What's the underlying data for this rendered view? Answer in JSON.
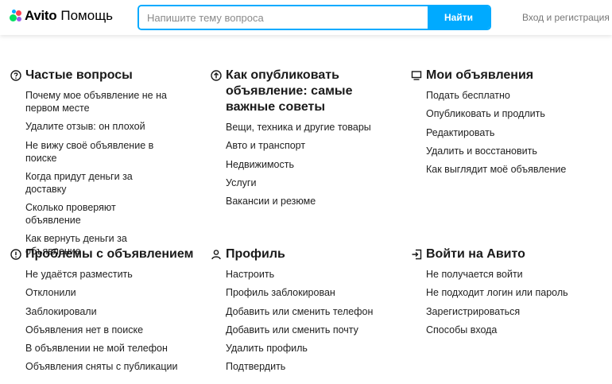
{
  "header": {
    "logo_brand": "Avito",
    "logo_sub": "Помощь",
    "search_placeholder": "Напишите тему вопроса",
    "search_button": "Найти",
    "login_link": "Вход и регистрация",
    "colors": {
      "accent": "#00aaff",
      "dot_green": "#04e061",
      "dot_red": "#ff4053",
      "dot_blue": "#965eeb",
      "dot_cyan": "#0af"
    }
  },
  "sections": [
    {
      "title": "Частые вопросы",
      "icon": "question-circle-icon",
      "items": [
        "Почему мое объявление не на первом месте",
        "Удалите отзыв: он плохой",
        "Не вижу своё объявление в поиске",
        "Когда придут деньги за доставку",
        "Сколько проверяют объявление",
        "Как вернуть деньги за объявление"
      ]
    },
    {
      "title": "Как опубликовать объявление: самые важные советы",
      "icon": "upload-circle-icon",
      "items": [
        "Вещи, техника и другие товары",
        "Авто и транспорт",
        "Недвижимость",
        "Услуги",
        "Вакансии и резюме"
      ]
    },
    {
      "title": "Мои объявления",
      "icon": "monitor-icon",
      "items": [
        "Подать бесплатно",
        "Опубликовать и продлить",
        "Редактировать",
        "Удалить и восстановить",
        "Как выглядит моё объявление"
      ]
    },
    {
      "title": "Проблемы с объявлением",
      "icon": "exclamation-circle-icon",
      "items": [
        "Не удаётся разместить",
        "Отклонили",
        "Заблокировали",
        "Объявления нет в поиске",
        "В объявлении не мой телефон",
        "Объявления сняты с публикации"
      ]
    },
    {
      "title": "Профиль",
      "icon": "user-icon",
      "items": [
        "Настроить",
        "Профиль заблокирован",
        "Добавить или сменить телефон",
        "Добавить или сменить почту",
        "Удалить профиль",
        "Подтвердить"
      ]
    },
    {
      "title": "Войти на Авито",
      "icon": "login-icon",
      "items": [
        "Не получается войти",
        "Не подходит логин или пароль",
        "Зарегистрироваться",
        "Способы входа"
      ]
    }
  ]
}
